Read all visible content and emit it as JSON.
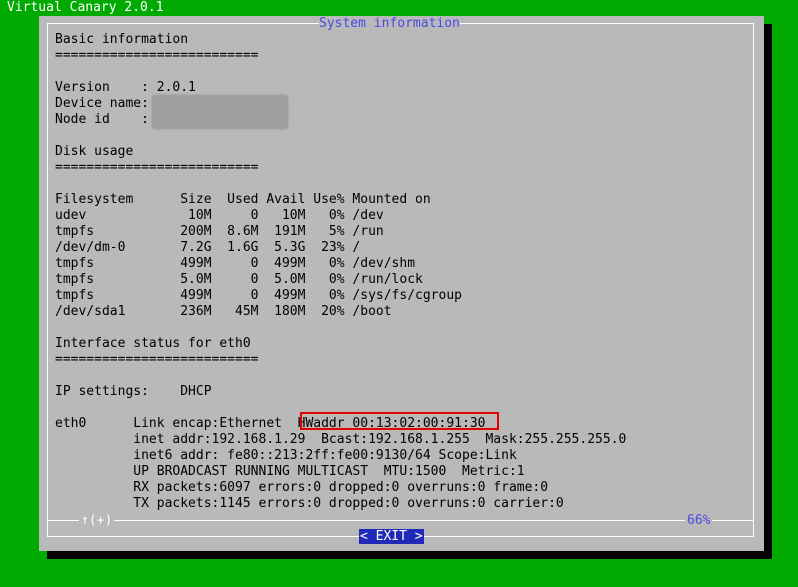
{
  "app_title": "Virtual Canary 2.0.1",
  "dialog": {
    "title": "System information",
    "scroll_indicator": "↑(+)",
    "scroll_percent": "66%",
    "exit_label": "< EXIT >"
  },
  "lines": [
    "Basic information",
    "==========================",
    "",
    "Version    : 2.0.1",
    "Device name:",
    "Node id    :",
    "",
    "Disk usage",
    "==========================",
    "",
    "Filesystem      Size  Used Avail Use% Mounted on",
    "udev             10M     0   10M   0% /dev",
    "tmpfs           200M  8.6M  191M   5% /run",
    "/dev/dm-0       7.2G  1.6G  5.3G  23% /",
    "tmpfs           499M     0  499M   0% /dev/shm",
    "tmpfs           5.0M     0  5.0M   0% /run/lock",
    "tmpfs           499M     0  499M   0% /sys/fs/cgroup",
    "/dev/sda1       236M   45M  180M  20% /boot",
    "",
    "Interface status for eth0",
    "==========================",
    "",
    "IP settings:    DHCP",
    "",
    "eth0      Link encap:Ethernet  HWaddr 00:13:02:00:91:30",
    "          inet addr:192.168.1.29  Bcast:192.168.1.255  Mask:255.255.255.0",
    "          inet6 addr: fe80::213:2ff:fe00:9130/64 Scope:Link",
    "          UP BROADCAST RUNNING MULTICAST  MTU:1500  Metric:1",
    "          RX packets:6097 errors:0 dropped:0 overruns:0 frame:0",
    "          TX packets:1145 errors:0 dropped:0 overruns:0 carrier:0"
  ]
}
